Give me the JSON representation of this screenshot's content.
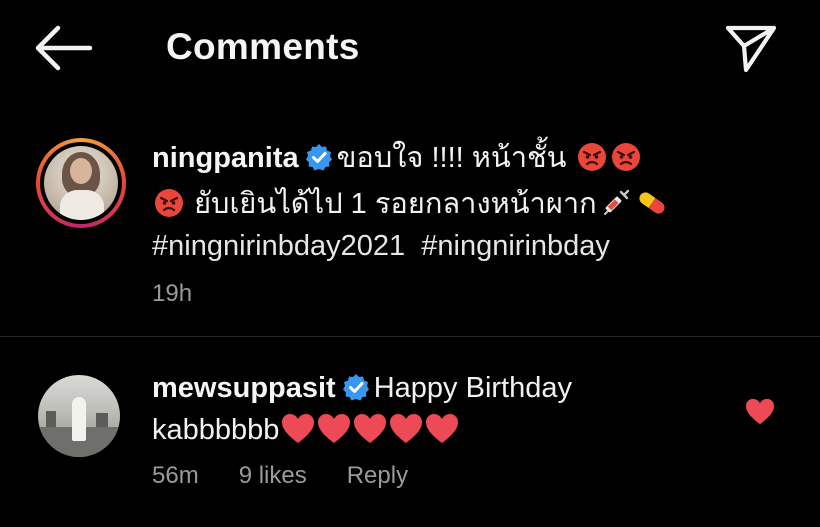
{
  "header": {
    "title": "Comments",
    "back_icon": "arrow-left-icon",
    "send_icon": "paper-plane-icon"
  },
  "caption": {
    "username": "ningpanita",
    "line1_text": "ขอบใจ !!!! หน้าชั้น",
    "line2_text": "ยับเยินได้ไป 1 รอยกลางหน้าผาก",
    "hashtag1": "#ningnirinbday2021",
    "hashtag2": "#ningnirinbday",
    "time": "19h"
  },
  "reply": {
    "username": "mewsuppasit",
    "text_line1": "Happy Birthday",
    "text_line2": "kabbbbbb",
    "time": "56m",
    "likes": "9 likes",
    "reply_label": "Reply"
  },
  "colors": {
    "background": "#000000",
    "verified": "#3897f0",
    "heart": "#ed4956",
    "angry_emoji": "#e8473a",
    "meta_text": "#9a9a9a"
  }
}
